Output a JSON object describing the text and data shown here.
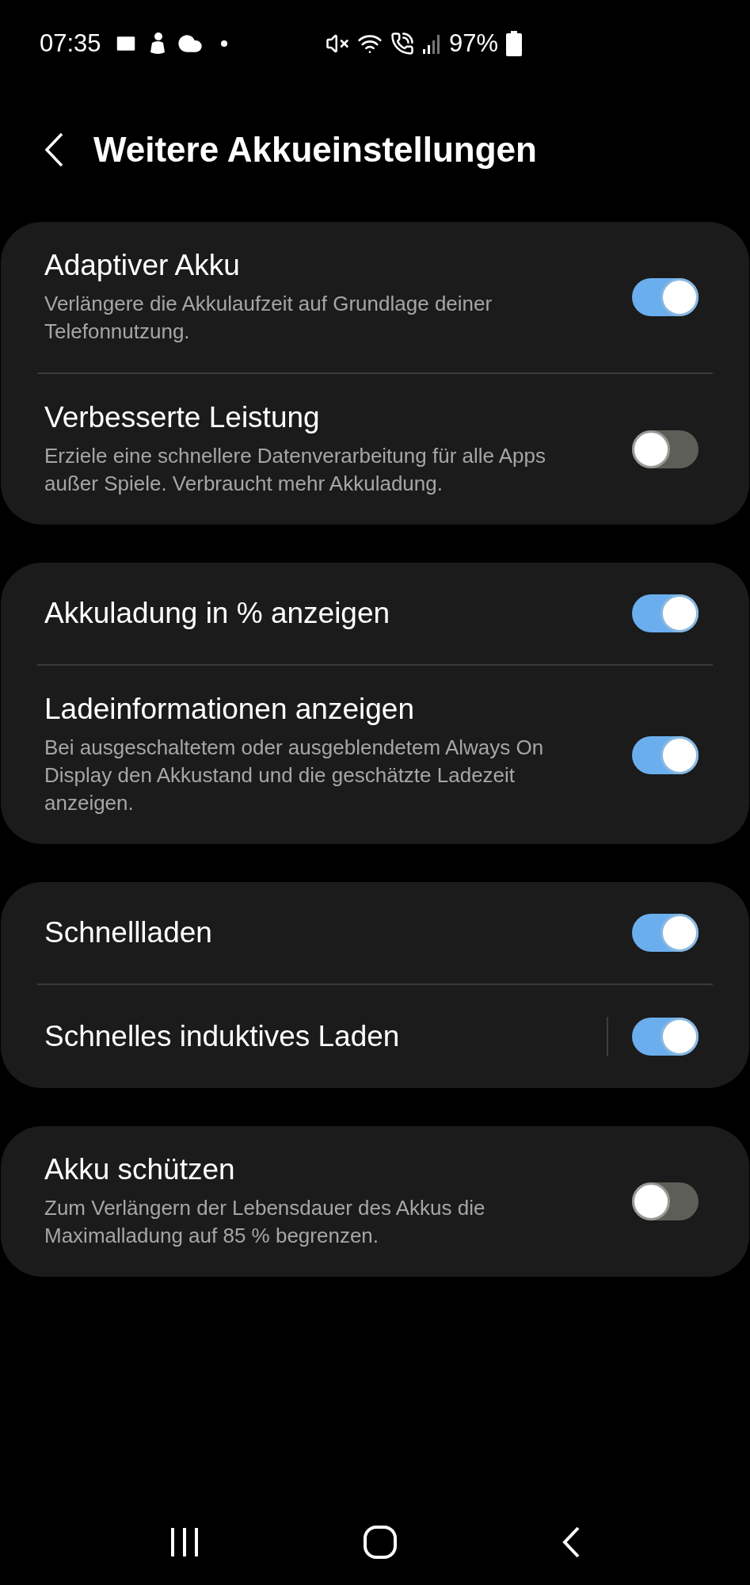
{
  "status_bar": {
    "time": "07:35",
    "battery": "97%"
  },
  "header": {
    "title": "Weitere Akkueinstellungen"
  },
  "groups": [
    {
      "items": [
        {
          "title": "Adaptiver Akku",
          "description": "Verlängere die Akkulaufzeit auf Grundlage deiner Telefonnutzung.",
          "on": true,
          "separator": false
        },
        {
          "title": "Verbesserte Leistung",
          "description": "Erziele eine schnellere Datenverarbeitung für alle Apps außer Spiele. Verbraucht mehr Akkuladung.",
          "on": false,
          "separator": false
        }
      ]
    },
    {
      "items": [
        {
          "title": "Akkuladung in % anzeigen",
          "on": true,
          "separator": false
        },
        {
          "title": "Ladeinformationen anzeigen",
          "description": "Bei ausgeschaltetem oder ausgeblendetem Always On Display den Akkustand und die geschätzte Ladezeit anzeigen.",
          "on": true,
          "separator": false
        }
      ]
    },
    {
      "items": [
        {
          "title": "Schnellladen",
          "on": true,
          "separator": false
        },
        {
          "title": "Schnelles induktives Laden",
          "on": true,
          "separator": true
        }
      ]
    },
    {
      "items": [
        {
          "title": "Akku schützen",
          "description": "Zum Verlängern der Lebensdauer des Akkus die Maximalladung auf 85 % begrenzen.",
          "on": false,
          "separator": false
        }
      ]
    }
  ]
}
